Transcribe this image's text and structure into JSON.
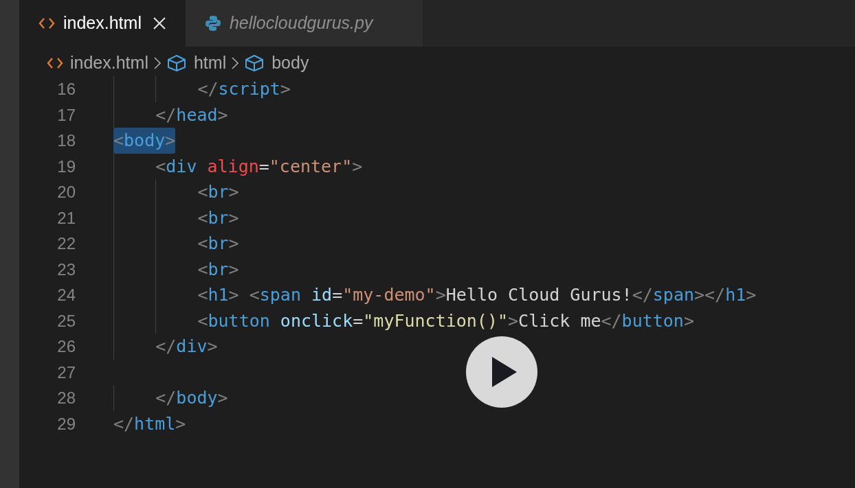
{
  "tabs": [
    {
      "label": "index.html",
      "kind": "html",
      "selected": true,
      "italic": false
    },
    {
      "label": "hellocloudgurus.py",
      "kind": "python",
      "selected": false,
      "italic": true
    }
  ],
  "breadcrumbs": [
    {
      "label": "index.html",
      "kind": "html"
    },
    {
      "label": "html",
      "kind": "element"
    },
    {
      "label": "body",
      "kind": "element"
    }
  ],
  "editor": {
    "lines": [
      {
        "number": "16",
        "tokens": [
          {
            "kind": "punct",
            "text": "        </"
          },
          {
            "kind": "tag",
            "text": "script"
          },
          {
            "kind": "punct",
            "text": ">"
          }
        ]
      },
      {
        "number": "17",
        "tokens": [
          {
            "kind": "punct",
            "text": "    </"
          },
          {
            "kind": "tag",
            "text": "head"
          },
          {
            "kind": "punct",
            "text": ">"
          }
        ]
      },
      {
        "number": "18",
        "highlighted": true,
        "tokens": [
          {
            "kind": "punct",
            "text": "<"
          },
          {
            "kind": "tag",
            "text": "body"
          },
          {
            "kind": "punct",
            "text": ">"
          }
        ]
      },
      {
        "number": "19",
        "tokens": [
          {
            "kind": "punct",
            "text": "    <"
          },
          {
            "kind": "tag",
            "text": "div"
          },
          {
            "kind": "attr",
            "text": " align"
          },
          {
            "kind": "text",
            "text": "="
          },
          {
            "kind": "string",
            "text": "\"center\""
          },
          {
            "kind": "punct",
            "text": ">"
          }
        ]
      },
      {
        "number": "20",
        "tokens": [
          {
            "kind": "punct",
            "text": "        <"
          },
          {
            "kind": "tag",
            "text": "br"
          },
          {
            "kind": "punct",
            "text": ">"
          }
        ]
      },
      {
        "number": "21",
        "tokens": [
          {
            "kind": "punct",
            "text": "        <"
          },
          {
            "kind": "tag",
            "text": "br"
          },
          {
            "kind": "punct",
            "text": ">"
          }
        ]
      },
      {
        "number": "22",
        "tokens": [
          {
            "kind": "punct",
            "text": "        <"
          },
          {
            "kind": "tag",
            "text": "br"
          },
          {
            "kind": "punct",
            "text": ">"
          }
        ]
      },
      {
        "number": "23",
        "tokens": [
          {
            "kind": "punct",
            "text": "        <"
          },
          {
            "kind": "tag",
            "text": "br"
          },
          {
            "kind": "punct",
            "text": ">"
          }
        ]
      },
      {
        "number": "24",
        "tokens": [
          {
            "kind": "punct",
            "text": "        <"
          },
          {
            "kind": "tag",
            "text": "h1"
          },
          {
            "kind": "punct",
            "text": "> <"
          },
          {
            "kind": "tag",
            "text": "span"
          },
          {
            "kind": "attr2",
            "text": " id"
          },
          {
            "kind": "text",
            "text": "="
          },
          {
            "kind": "string",
            "text": "\"my-demo\""
          },
          {
            "kind": "punct",
            "text": ">"
          },
          {
            "kind": "text",
            "text": "Hello Cloud Gurus!"
          },
          {
            "kind": "punct",
            "text": "</"
          },
          {
            "kind": "tag",
            "text": "span"
          },
          {
            "kind": "punct",
            "text": "></"
          },
          {
            "kind": "tag",
            "text": "h1"
          },
          {
            "kind": "punct",
            "text": ">"
          }
        ]
      },
      {
        "number": "25",
        "tokens": [
          {
            "kind": "punct",
            "text": "        <"
          },
          {
            "kind": "tag",
            "text": "button"
          },
          {
            "kind": "attr2",
            "text": " onclick"
          },
          {
            "kind": "text",
            "text": "="
          },
          {
            "kind": "func",
            "text": "\"myFunction()\""
          },
          {
            "kind": "punct",
            "text": ">"
          },
          {
            "kind": "text",
            "text": "Click me"
          },
          {
            "kind": "punct",
            "text": "</"
          },
          {
            "kind": "tag",
            "text": "button"
          },
          {
            "kind": "punct",
            "text": ">"
          }
        ]
      },
      {
        "number": "26",
        "tokens": [
          {
            "kind": "punct",
            "text": "    </"
          },
          {
            "kind": "tag",
            "text": "div"
          },
          {
            "kind": "punct",
            "text": ">"
          }
        ]
      },
      {
        "number": "27"
      },
      {
        "number": "28",
        "tokens": [
          {
            "kind": "punct",
            "text": "    </"
          },
          {
            "kind": "tag",
            "text": "body"
          },
          {
            "kind": "punct",
            "text": ">"
          }
        ]
      },
      {
        "number": "29",
        "tokens": [
          {
            "kind": "punct",
            "text": "</"
          },
          {
            "kind": "tag",
            "text": "html"
          },
          {
            "kind": "punct",
            "text": ">"
          }
        ]
      }
    ]
  }
}
